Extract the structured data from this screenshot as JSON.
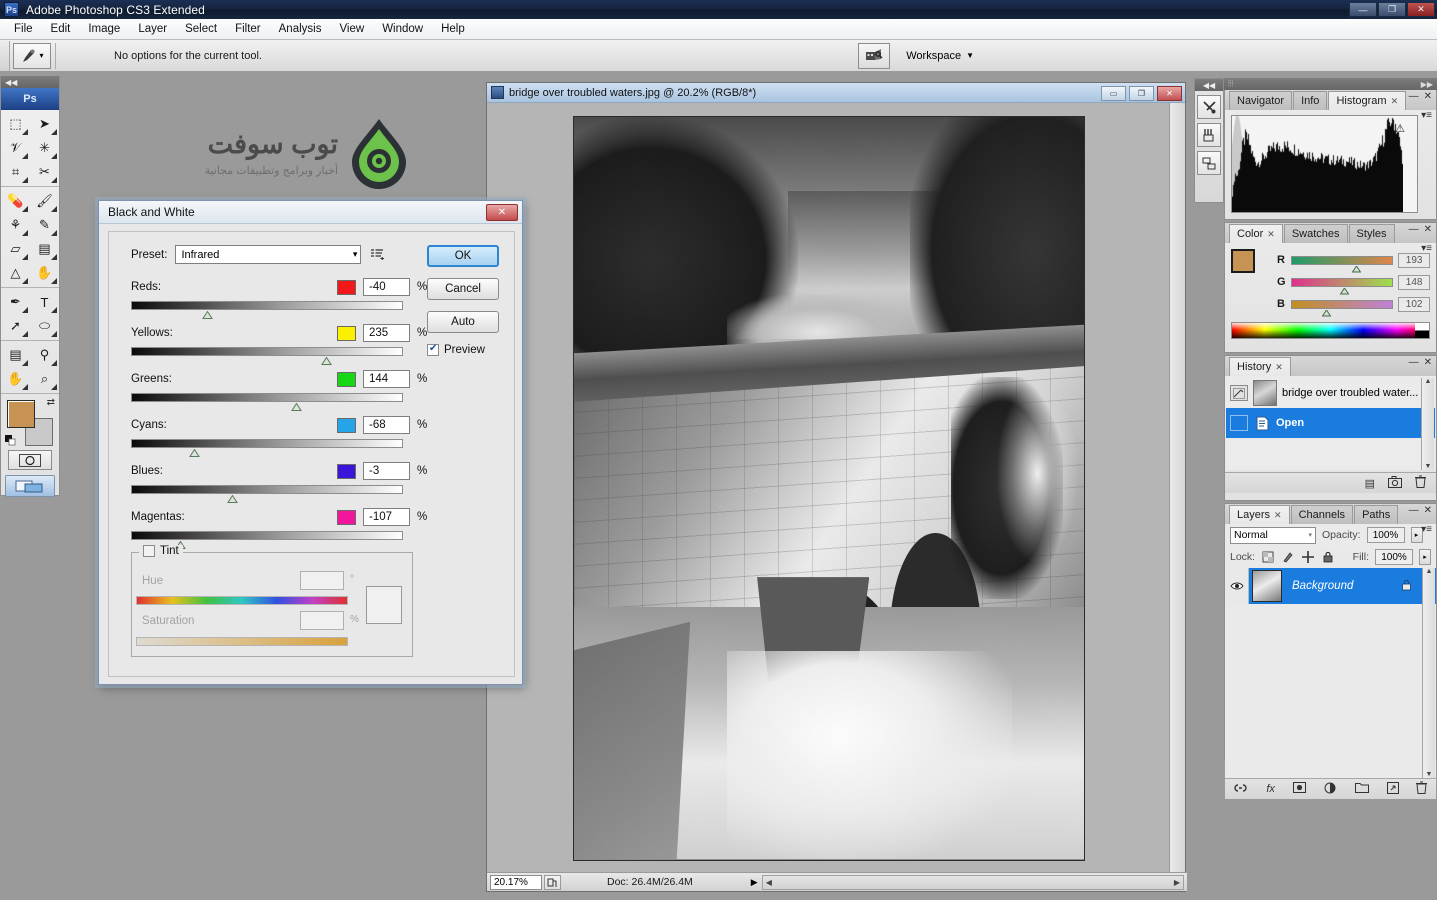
{
  "window": {
    "app_title": "Adobe Photoshop CS3 Extended",
    "ps_badge": "Ps",
    "minimize": "—",
    "maximize": "❐",
    "close": "✕"
  },
  "menubar": {
    "items": [
      "File",
      "Edit",
      "Image",
      "Layer",
      "Select",
      "Filter",
      "Analysis",
      "View",
      "Window",
      "Help"
    ]
  },
  "options_bar": {
    "message": "No options for the current tool.",
    "workspace_label": "Workspace",
    "workspace_caret": "▼",
    "bridge_icon": "bridge-icon",
    "tool_icon": "eyedropper-icon",
    "tool_caret": "▾"
  },
  "toolbox": {
    "badge": "Ps",
    "grip": "◀◀",
    "tools": [
      {
        "name": "marquee-tool",
        "glyph": "⬚"
      },
      {
        "name": "move-tool",
        "glyph": "➤"
      },
      {
        "name": "lasso-tool",
        "glyph": "𝒱"
      },
      {
        "name": "magic-wand-tool",
        "glyph": "✳"
      },
      {
        "name": "crop-tool",
        "glyph": "⌗"
      },
      {
        "name": "slice-tool",
        "glyph": "✂"
      },
      {
        "name": "healing-brush-tool",
        "glyph": "💊"
      },
      {
        "name": "brush-tool",
        "glyph": "🖌"
      },
      {
        "name": "clone-stamp-tool",
        "glyph": "⚘"
      },
      {
        "name": "history-brush-tool",
        "glyph": "✎"
      },
      {
        "name": "eraser-tool",
        "glyph": "▱"
      },
      {
        "name": "gradient-tool",
        "glyph": "▤"
      },
      {
        "name": "blur-tool",
        "glyph": "△"
      },
      {
        "name": "dodge-tool",
        "glyph": "✋"
      },
      {
        "name": "pen-tool",
        "glyph": "✒"
      },
      {
        "name": "type-tool",
        "glyph": "T"
      },
      {
        "name": "path-selection-tool",
        "glyph": "➚"
      },
      {
        "name": "ellipse-tool",
        "glyph": "⬭"
      },
      {
        "name": "notes-tool",
        "glyph": "▤"
      },
      {
        "name": "eyedropper-tool",
        "glyph": "⚲"
      },
      {
        "name": "hand-tool",
        "glyph": "✋"
      },
      {
        "name": "zoom-tool",
        "glyph": "⌕"
      }
    ],
    "foreground_color": "#c79355",
    "background_color": "#c9c9c9",
    "swap_glyph": "⇄",
    "quickmask_glyph": "◯",
    "screenmode_glyph": "▭"
  },
  "watermark": {
    "title": "توب سوفت",
    "subtitle": "أخبار وبرامج وتطبيقات مجانية",
    "logo_name": "topsoft-gear-logo"
  },
  "document": {
    "title": "bridge over troubled waters.jpg @ 20.2% (RGB/8*)",
    "minimize": "▭",
    "restore": "❐",
    "close": "✕",
    "status": {
      "zoom": "20.17%",
      "doc_info": "Doc: 26.4M/26.4M",
      "arrow": "▶",
      "scroll_left": "◀",
      "scroll_right": "▶"
    },
    "photo_alt": "black and white photo of a stone bridge over a rushing river"
  },
  "mini_dock": {
    "grip": "◀◀",
    "buttons": [
      {
        "name": "tool-presets-icon",
        "glyph": "✂"
      },
      {
        "name": "brushes-icon",
        "glyph": "🖌"
      },
      {
        "name": "clone-source-icon",
        "glyph": "⧉"
      }
    ]
  },
  "panels": {
    "dock_grip": "▶▶",
    "histogram": {
      "tabs": [
        "Navigator",
        "Info",
        "Histogram"
      ],
      "active_tab": "Histogram",
      "close_x": "✕",
      "collapse": "—",
      "menu": "▾≡",
      "warning_glyph": "⚠"
    },
    "color": {
      "tabs": [
        "Color",
        "Swatches",
        "Styles"
      ],
      "active_tab": "Color",
      "close_x": "✕",
      "collapse": "—",
      "menu": "▾≡",
      "channels": [
        {
          "label": "R",
          "value": "193"
        },
        {
          "label": "G",
          "value": "148"
        },
        {
          "label": "B",
          "value": "102"
        }
      ],
      "foreground": "#c79355",
      "background": "#c9c9c9"
    },
    "history": {
      "tabs": [
        "History"
      ],
      "active_tab": "History",
      "close_x": "✕",
      "collapse": "—",
      "menu": "▾≡",
      "snapshot": "bridge over troubled water...",
      "states": [
        {
          "label": "Open",
          "selected": true
        }
      ],
      "footer_icons": [
        {
          "name": "new-document-from-state-icon",
          "glyph": "▤"
        },
        {
          "name": "new-snapshot-icon",
          "glyph": "📷"
        },
        {
          "name": "delete-state-icon",
          "glyph": "🗑"
        }
      ]
    },
    "layers": {
      "tabs": [
        "Layers",
        "Channels",
        "Paths"
      ],
      "active_tab": "Layers",
      "close_x": "✕",
      "collapse": "—",
      "menu": "▾≡",
      "blend_mode": "Normal",
      "blend_caret": "▾",
      "opacity_label": "Opacity:",
      "opacity_value": "100%",
      "fill_label": "Fill:",
      "fill_value": "100%",
      "lock_label": "Lock:",
      "lock_icons": [
        {
          "name": "lock-transparent-pixels-icon",
          "glyph": "▨"
        },
        {
          "name": "lock-image-pixels-icon",
          "glyph": "🖌"
        },
        {
          "name": "lock-position-icon",
          "glyph": "✥"
        },
        {
          "name": "lock-all-icon",
          "glyph": "🔒"
        }
      ],
      "items": [
        {
          "name": "Background",
          "visible": true,
          "locked": true,
          "lock_glyph": "🔒",
          "eye_glyph": "👁"
        }
      ],
      "footer_icons": [
        {
          "name": "link-layers-icon",
          "glyph": "⛓"
        },
        {
          "name": "layer-style-icon",
          "glyph": "fx"
        },
        {
          "name": "add-layer-mask-icon",
          "glyph": "◻"
        },
        {
          "name": "adjustment-layer-icon",
          "glyph": "◐"
        },
        {
          "name": "new-group-icon",
          "glyph": "🗀"
        },
        {
          "name": "new-layer-icon",
          "glyph": "▣"
        },
        {
          "name": "delete-layer-icon",
          "glyph": "🗑"
        }
      ]
    }
  },
  "bw_dialog": {
    "title": "Black and White",
    "close_glyph": "✕",
    "preset_label": "Preset:",
    "preset_value": "Infrared",
    "preset_caret": "▾",
    "preset_menu_icon": "preset-options-icon",
    "percent_sign": "%",
    "channels": [
      {
        "label": "Reds:",
        "value": "-40",
        "color": "#f01818",
        "pos": 26
      },
      {
        "label": "Yellows:",
        "value": "235",
        "color": "#fbf000",
        "pos": 70
      },
      {
        "label": "Greens:",
        "value": "144",
        "color": "#16d616",
        "pos": 59
      },
      {
        "label": "Cyans:",
        "value": "-68",
        "color": "#25a4e8",
        "pos": 21
      },
      {
        "label": "Blues:",
        "value": "-3",
        "color": "#3a14d8",
        "pos": 35
      },
      {
        "label": "Magentas:",
        "value": "-107",
        "color": "#f2169c",
        "pos": 16
      }
    ],
    "tint": {
      "label": "Tint",
      "checked": false,
      "hue_label": "Hue",
      "hue_value": "",
      "degree_sign": "°",
      "saturation_label": "Saturation",
      "saturation_value": "",
      "percent_sign": "%"
    },
    "buttons": {
      "ok": "OK",
      "cancel": "Cancel",
      "auto": "Auto"
    },
    "preview": {
      "label": "Preview",
      "checked": true
    }
  }
}
